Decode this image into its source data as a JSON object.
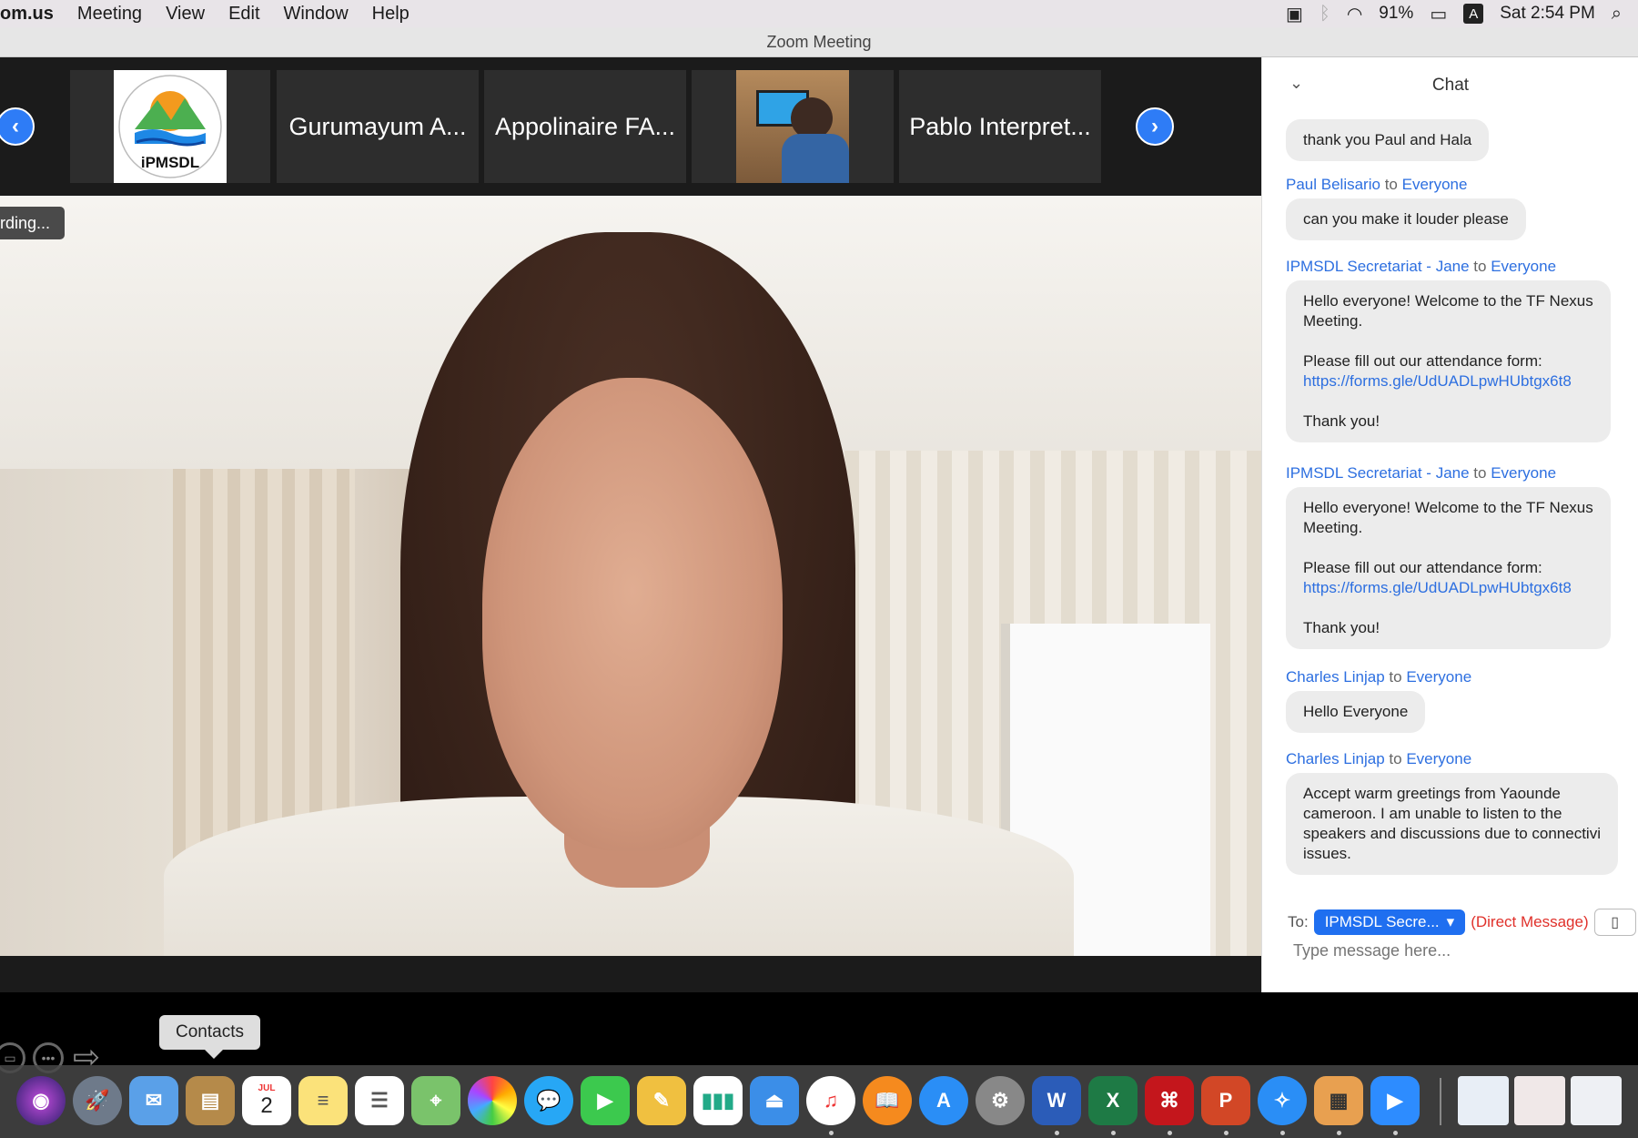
{
  "menubar": {
    "app_name": "om.us",
    "menus": [
      "Meeting",
      "View",
      "Edit",
      "Window",
      "Help"
    ],
    "battery": "91%",
    "input_source": "A",
    "clock": "Sat 2:54 PM"
  },
  "window": {
    "title": "Zoom Meeting"
  },
  "gallery": {
    "tiles": [
      {
        "type": "logo",
        "text": "iPMSDL"
      },
      {
        "type": "name",
        "text": "Gurumayum A..."
      },
      {
        "type": "name",
        "text": "Appolinaire FA..."
      },
      {
        "type": "video",
        "text": ""
      },
      {
        "type": "name",
        "text": "Pablo Interpret..."
      }
    ]
  },
  "video": {
    "badge": "rding..."
  },
  "chat": {
    "title": "Chat",
    "messages": [
      {
        "sender": "",
        "to_word": "",
        "recipient": "",
        "lines": [
          "thank you Paul and Hala"
        ]
      },
      {
        "sender": "Paul Belisario",
        "to_word": "to",
        "recipient": "Everyone",
        "lines": [
          "can you make it louder please"
        ]
      },
      {
        "sender": "IPMSDL Secretariat - Jane",
        "to_word": "to",
        "recipient": "Everyone",
        "lines": [
          "Hello everyone! Welcome to the TF Nexus",
          "Meeting.",
          "",
          "Please fill out our attendance form:",
          "https://forms.gle/UdUADLpwHUbtgx6t8",
          "",
          "Thank you!"
        ]
      },
      {
        "sender": "IPMSDL Secretariat - Jane",
        "to_word": "to",
        "recipient": "Everyone",
        "lines": [
          "Hello everyone! Welcome to the TF Nexus",
          "Meeting.",
          "",
          "Please fill out our attendance form:",
          "https://forms.gle/UdUADLpwHUbtgx6t8",
          "",
          "Thank you!"
        ]
      },
      {
        "sender": "Charles Linjap",
        "to_word": "to",
        "recipient": "Everyone",
        "lines": [
          "Hello Everyone"
        ]
      },
      {
        "sender": "Charles Linjap",
        "to_word": "to",
        "recipient": "Everyone",
        "lines": [
          "Accept warm greetings from Yaounde",
          "cameroon. I am unable to listen to the",
          "speakers and discussions due to connectivi",
          "issues."
        ]
      }
    ],
    "to_label": "To:",
    "to_value": "IPMSDL Secre...",
    "direct_label": "(Direct Message)",
    "input_placeholder": "Type message here..."
  },
  "dock": {
    "tooltip": "Contacts",
    "calendar_month": "JUL",
    "calendar_day": "2",
    "word_letter": "W",
    "excel_letter": "X",
    "ppt_letter": "P"
  }
}
